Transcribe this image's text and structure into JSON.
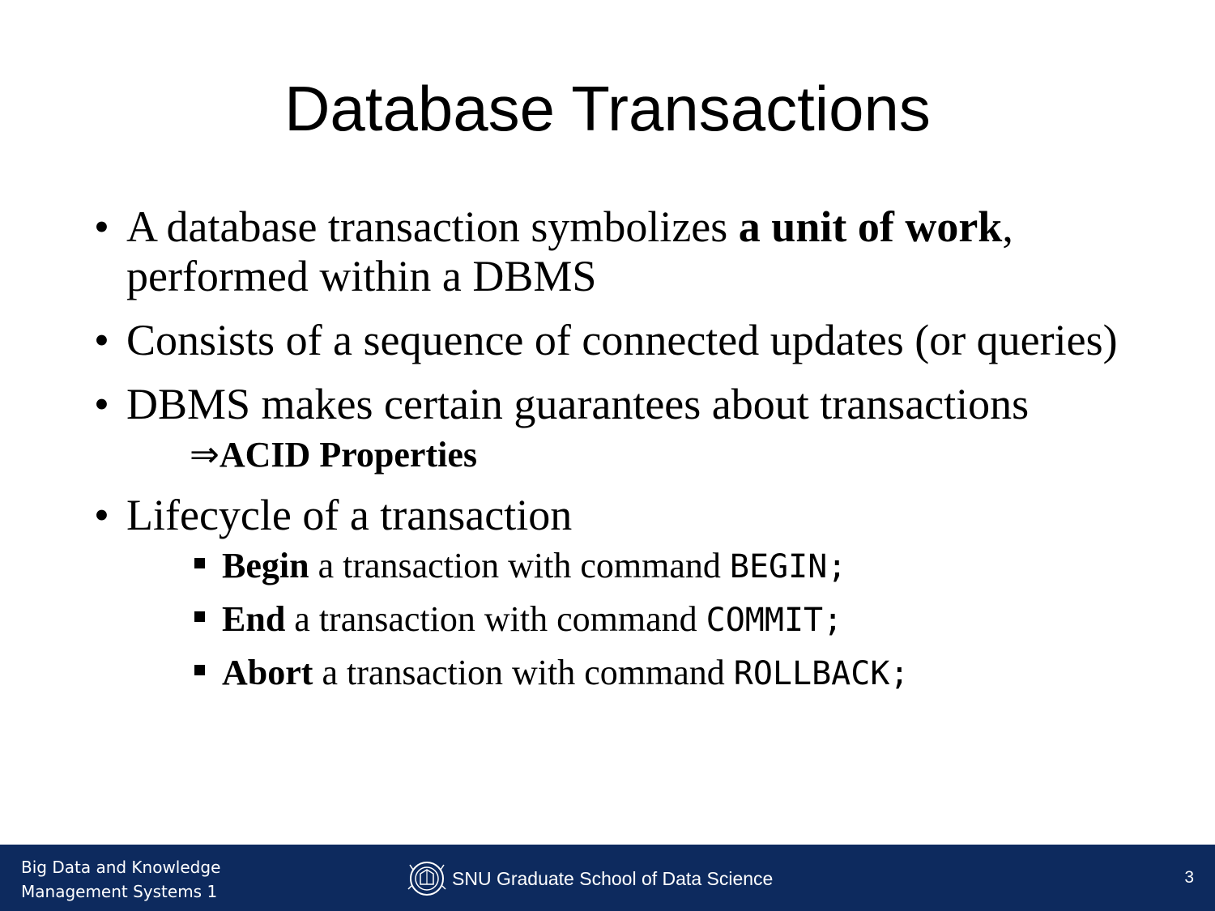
{
  "slide": {
    "title": "Database Transactions"
  },
  "bullets": [
    {
      "pre": "A database transaction symbolizes ",
      "bold": "a unit of work",
      "post": ", performed within a DBMS"
    },
    {
      "text": "Consists of a sequence of connected updates (or queries)"
    },
    {
      "text": "DBMS makes certain guarantees about transactions",
      "arrow": "⇒",
      "arrow_text": "ACID Properties"
    },
    {
      "text": "Lifecycle of a transaction",
      "items": [
        {
          "bold": "Begin",
          "text": " a transaction with command ",
          "code": "BEGIN;"
        },
        {
          "bold": "End",
          "text": " a transaction with command ",
          "code": "COMMIT;"
        },
        {
          "bold": "Abort",
          "text": " a transaction with command ",
          "code": "ROLLBACK;"
        }
      ]
    }
  ],
  "footer": {
    "course_line1": "Big Data and Knowledge",
    "course_line2": "Management Systems 1",
    "school": "SNU Graduate School of Data Science",
    "logo_icon": "snu-emblem-icon",
    "page_number": "3",
    "background_color": "#0d2a5e"
  }
}
